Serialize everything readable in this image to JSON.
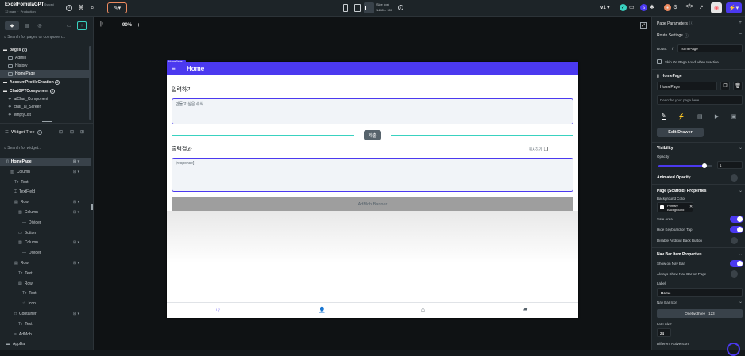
{
  "top": {
    "project": "ExcelFomulaGPT",
    "synced": "Synced",
    "branch": "12 main",
    "env": "Production",
    "version": "v1",
    "size_label": "Size (px)",
    "size_value": "1440 × 900"
  },
  "left": {
    "search_pages": "Search for pages or componen...",
    "pages_label": "pages",
    "pages_count": "3",
    "pages": [
      "Admin",
      "History",
      "HomePage"
    ],
    "profile_label": "AccountProfileCreation",
    "profile_count": "2",
    "component_label": "ChatGPTComponent",
    "component_count": "4",
    "components": [
      "aiChat_Component",
      "chat_ai_Screen",
      "emptyList"
    ],
    "widget_tree": "Widget Tree",
    "search_widget": "Search for widget...",
    "tree": [
      "HomePage",
      "Column",
      "Text",
      "TextField",
      "Row",
      "Column",
      "Divider",
      "Button",
      "Column",
      "Divider",
      "Row",
      "Text",
      "Row",
      "Text",
      "Icon",
      "Container",
      "Text",
      "AdMob",
      "AppBar"
    ]
  },
  "canvas": {
    "zoom": "90%",
    "appbar_tag": "HomePage",
    "appbar_title": "Home",
    "input_label": "입력하기",
    "input_placeholder": "만들고 싶은 수식",
    "submit": "제출",
    "output_label": "출력결과",
    "copy_label": "복사하기",
    "response": "[response]",
    "admob": "AdMob Banner",
    "nav_label": "\\ (/"
  },
  "right": {
    "page_params": "Page Parameters",
    "route_settings": "Route Settings",
    "route_label": "Route:",
    "route_slash": "/",
    "route_value": "homePage",
    "skip_load": "Skip On Page Load when Inactive",
    "page_tag": "HomePage",
    "page_name": "HomePage",
    "describe_placeholder": "Describe your page here...",
    "edit_drawer": "Edit Drawer",
    "visibility": "Visibility",
    "opacity_label": "Opacity",
    "opacity_value": "1",
    "opacity_level": 0.85,
    "animated_opacity": "Animated Opacity",
    "scaffold": "Page (Scaffold) Properties",
    "bg_color_label": "Background Color",
    "bg_color_value": "Primary Background",
    "safe_area": "Safe Area",
    "hide_keyboard": "Hide Keyboard on Tap",
    "disable_back": "Disable Android Back Button",
    "navbar_props": "Nav Bar Item Properties",
    "show_navbar": "Show on Nav Bar",
    "always_show": "Always Show Nav Bar on Page",
    "label_title": "Label",
    "label_value": "Home",
    "navbar_icon": "Nav Bar Icon",
    "icon_name": "Onetwothree",
    "icon_size_label": "Icon Size",
    "icon_size_value": "24",
    "diff_active": "Different Active Icon"
  },
  "colors": {
    "accent": "#4b39ef",
    "appbar": "#4b39ef",
    "border": "#4b39ef",
    "green": "#39d2c0",
    "bg": "#14181b",
    "panel": "#1d2428"
  }
}
